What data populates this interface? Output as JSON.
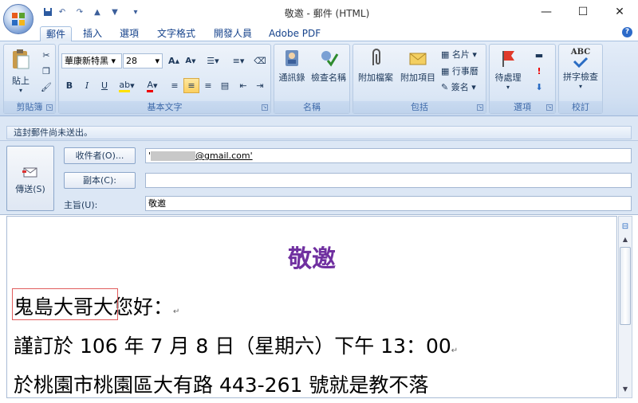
{
  "window": {
    "title": "敬邀 - 郵件 (HTML)",
    "minimize": "—",
    "maximize": "☐",
    "close": "✕"
  },
  "qat": {
    "save": "💾",
    "undo": "↶",
    "redo": "↷",
    "up": "▲",
    "down": "▼",
    "more": "▾"
  },
  "tabs": [
    "郵件",
    "插入",
    "選項",
    "文字格式",
    "開發人員",
    "Adobe PDF"
  ],
  "help": "?",
  "ribbon": {
    "clipboard": {
      "label": "剪貼簿",
      "paste": "貼上",
      "paste_arrow": "▾"
    },
    "basic_text": {
      "label": "基本文字",
      "font": "華康新特黑",
      "size": "28",
      "grow": "A",
      "shrink": "A",
      "bold": "B",
      "italic": "I",
      "underline": "U"
    },
    "names": {
      "label": "名稱",
      "address_book": "通訊錄",
      "check_names": "檢查名稱"
    },
    "include": {
      "label": "包括",
      "attach_file": "附加檔案",
      "attach_item": "附加項目",
      "business_card": "名片",
      "calendar": "行事曆",
      "signature": "簽名"
    },
    "options": {
      "label": "選項",
      "follow_up": "待處理"
    },
    "proofing": {
      "label": "校訂",
      "spelling": "拼字檢查",
      "abc": "ABC"
    }
  },
  "infobar": {
    "text": "這封郵件尚未送出。"
  },
  "header": {
    "send": "傳送(S)",
    "to_button": "收件者(O)...",
    "cc_button": "副本(C):",
    "subject_label": "主旨(U):",
    "to_value": "@gmail.com'",
    "to_prefix": "'",
    "cc_value": "",
    "subject_value": "敬邀"
  },
  "body": {
    "heading": "敬邀",
    "line1_name": "鬼島大哥大",
    "line1_rest": "您好：",
    "line2": "謹訂於 106 年 7 月 8 日（星期六）下午 13：00",
    "line3": "於桃園市桃園區大有路 443-261 號就是教不落",
    "para_mark": "↵"
  },
  "colors": {
    "heading": "#7030a0",
    "ribbon_text": "#1e395b",
    "highlight_box": "#e15c5c"
  }
}
